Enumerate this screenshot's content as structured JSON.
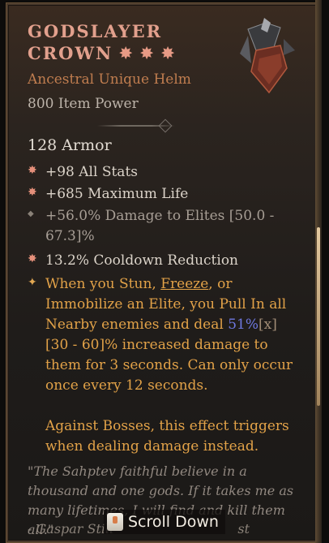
{
  "item": {
    "name_line1": "GODSLAYER",
    "name_line2": "CROWN",
    "title_stars": [
      "✸",
      "✸",
      "✸"
    ],
    "subtitle": "Ancestral Unique Helm",
    "power": "800 Item Power",
    "armor": "128 Armor",
    "stats": [
      "+98 All Stats",
      "+685 Maximum Life",
      "+56.0% Damage to Elites [50.0 - 67.3]%",
      "13.2% Cooldown Reduction"
    ],
    "unique": {
      "part1": "When you Stun, ",
      "freeze": "Freeze",
      "part2": ", or Immobilize an Elite, you Pull In all Nearby enemies and deal ",
      "value": "51%",
      "mult": "[x]",
      "range": " [30 - 60]%",
      "part3": " increased damage to them for 3 seconds. Can only occur once every 12 seconds.",
      "part4": "Against Bosses, this effect triggers when dealing damage instead."
    },
    "flavor": "\"The Sahptev faithful believe in a thousand and one gods. If it takes me as many lifetimes, I will find and kill them all.\"",
    "author": "- Gaspar Still",
    "author_tail": "st"
  },
  "scroll_hint": {
    "label": "Scroll Down",
    "icon": "mouse-scroll-icon"
  },
  "colors": {
    "unique_name": "#e2a08d",
    "unique_subtitle": "#c07d4f",
    "unique_power": "#e2a248",
    "highlight_value": "#6e78e0",
    "bg": "#1f1c1a"
  }
}
